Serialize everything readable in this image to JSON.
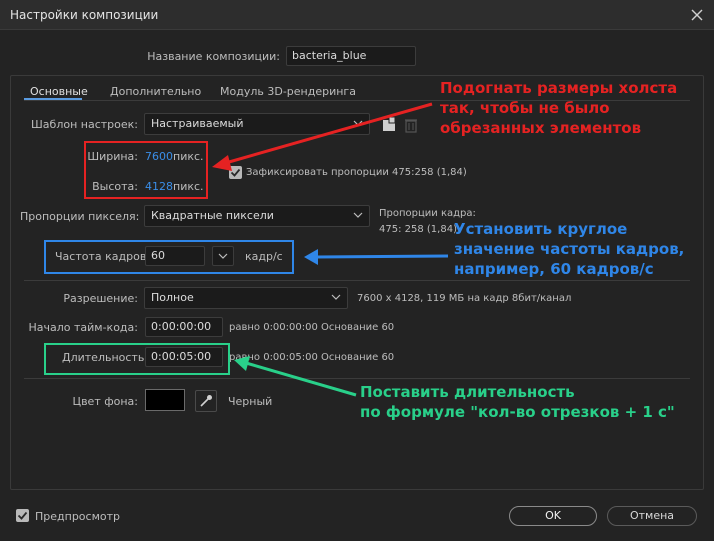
{
  "window": {
    "title": "Настройки композиции"
  },
  "composition_name": {
    "label": "Название композиции:",
    "value": "bacteria_blue"
  },
  "tabs": [
    {
      "label": "Основные",
      "active": true
    },
    {
      "label": "Дополнительно",
      "active": false
    },
    {
      "label": "Модуль 3D-рендеринга",
      "active": false
    }
  ],
  "preset": {
    "label": "Шаблон настроек:",
    "value": "Настраиваемый"
  },
  "width": {
    "label": "Ширина:",
    "value": "7600",
    "unit": "пикс."
  },
  "height": {
    "label": "Высота:",
    "value": "4128",
    "unit": "пикс."
  },
  "lock_aspect": {
    "label": "Зафиксировать пропорции 475:258 (1,84)",
    "checked": true
  },
  "pixel_aspect": {
    "label": "Пропорции пикселя:",
    "value": "Квадратные пиксели"
  },
  "frame_aspect": {
    "label": "Пропорции кадра:",
    "value": "475: 258 (1,84)"
  },
  "frame_rate": {
    "label": "Частота кадров:",
    "value": "60",
    "unit": "кадр/с"
  },
  "resolution": {
    "label": "Разрешение:",
    "value": "Полное",
    "info": "7600 x 4128, 119 МБ на кадр 8бит/канал"
  },
  "start_timecode": {
    "label": "Начало тайм-кода:",
    "value": "0:00:00:00",
    "info": "равно 0:00:00:00  Основание 60"
  },
  "duration": {
    "label": "Длительность:",
    "value": "0:00:05:00",
    "info": "равно 0:00:05:00  Основание 60"
  },
  "background": {
    "label": "Цвет фона:",
    "color_name": "Черный",
    "color": "#000000"
  },
  "preview": {
    "label": "Предпросмотр",
    "checked": true
  },
  "buttons": {
    "ok": "OK",
    "cancel": "Отмена"
  },
  "annotations": {
    "red": [
      "Подогнать размеры холста",
      "так, чтобы не было",
      "обрезанных элементов"
    ],
    "blue": [
      "Установить круглое",
      "значение частоты кадров,",
      "например, 60 кадров/с"
    ],
    "green": [
      "Поставить длительность",
      "по формуле \"кол-во отрезков + 1 с\""
    ]
  },
  "colors": {
    "annotation_red": "#e52222",
    "annotation_blue": "#2f86e8",
    "annotation_green": "#29d08a",
    "link_blue": "#3a8ee8"
  },
  "icons": {
    "close": "close-icon",
    "chevron": "chevron-down-icon",
    "save_preset": "save-preset-icon",
    "delete_preset": "trash-icon",
    "eyedropper": "eyedropper-icon",
    "checkbox": "checkmark-icon"
  }
}
